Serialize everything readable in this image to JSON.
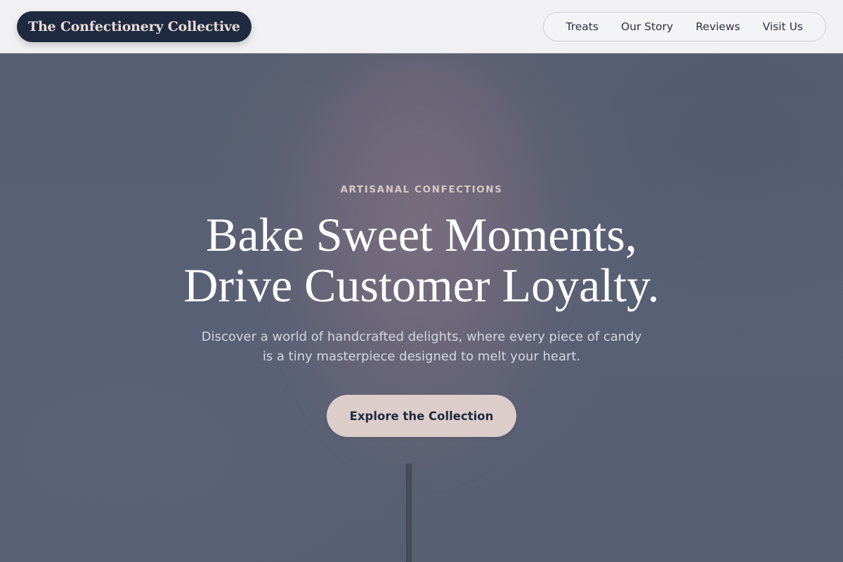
{
  "header": {
    "brand": "The Confectionery Collective",
    "nav": [
      {
        "label": "Treats"
      },
      {
        "label": "Our Story"
      },
      {
        "label": "Reviews"
      },
      {
        "label": "Visit Us"
      }
    ]
  },
  "hero": {
    "eyebrow": "ARTISANAL CONFECTIONS",
    "headline_line1": "Bake Sweet Moments,",
    "headline_line2": "Drive Customer Loyalty.",
    "subhead_line1": "Discover a world of handcrafted delights, where every piece of candy",
    "subhead_line2": "is a tiny masterpiece designed to melt your heart.",
    "cta_label": "Explore the Collection"
  },
  "colors": {
    "brand_pill": "#1f2a40",
    "brand_text": "#e7dcd8",
    "cta_bg": "#ddcdca",
    "cta_text": "#1f2a40",
    "eyebrow": "#d8c7c6",
    "hero_overlay": "#5a6374"
  }
}
